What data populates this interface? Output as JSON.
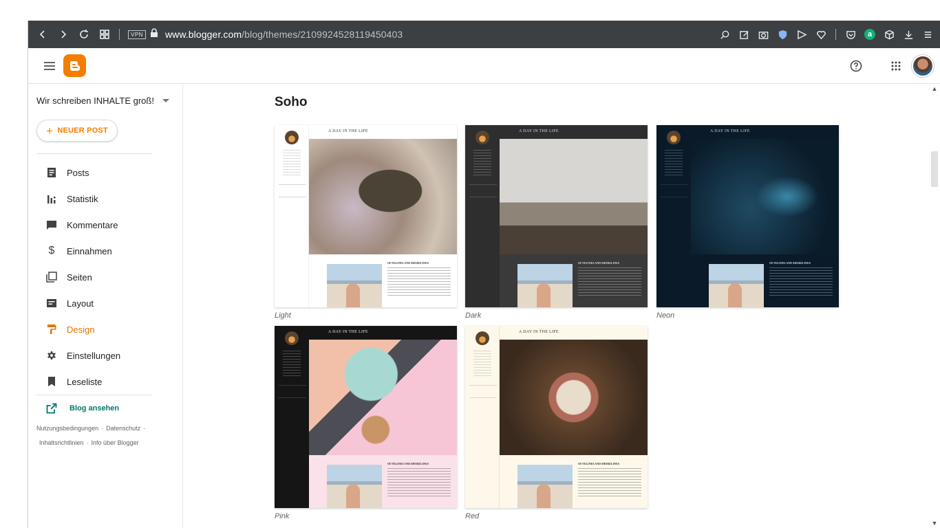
{
  "browser": {
    "url_domain": "www.blogger.com",
    "url_path": "/blog/themes/2109924528119450403",
    "vpn_label": "VPN"
  },
  "sidebar": {
    "blog_name": "Wir schreiben INHALTE groß!",
    "new_post_label": "NEUER POST",
    "items": [
      {
        "label": "Posts",
        "icon": "posts-icon",
        "active": false
      },
      {
        "label": "Statistik",
        "icon": "stats-icon",
        "active": false
      },
      {
        "label": "Kommentare",
        "icon": "comment-icon",
        "active": false
      },
      {
        "label": "Einnahmen",
        "icon": "dollar-icon",
        "active": false
      },
      {
        "label": "Seiten",
        "icon": "pages-icon",
        "active": false
      },
      {
        "label": "Layout",
        "icon": "layout-icon",
        "active": false
      },
      {
        "label": "Design",
        "icon": "paint-roller-icon",
        "active": true
      },
      {
        "label": "Einstellungen",
        "icon": "gear-icon",
        "active": false
      },
      {
        "label": "Leseliste",
        "icon": "bookmark-icon",
        "active": false
      }
    ],
    "view_blog_label": "Blog ansehen",
    "footer": {
      "terms": "Nutzungsbedingungen",
      "privacy": "Datenschutz",
      "content_policy": "Inhaltsrichtlinien",
      "about": "Info über Blogger"
    }
  },
  "main": {
    "theme_family": "Soho",
    "template_header_text": "A DAY IN THE LIFE",
    "template_post_title": "OF FELINES AND SHORELINES",
    "template_author": "Jason Rogers",
    "themes": [
      {
        "label": "Light"
      },
      {
        "label": "Dark"
      },
      {
        "label": "Neon"
      },
      {
        "label": "Pink"
      },
      {
        "label": "Red"
      }
    ]
  },
  "colors": {
    "accent": "#f57d00",
    "active_nav": "#e37400",
    "view_blog": "#00796b",
    "toolbar_bg": "#3c4043"
  }
}
